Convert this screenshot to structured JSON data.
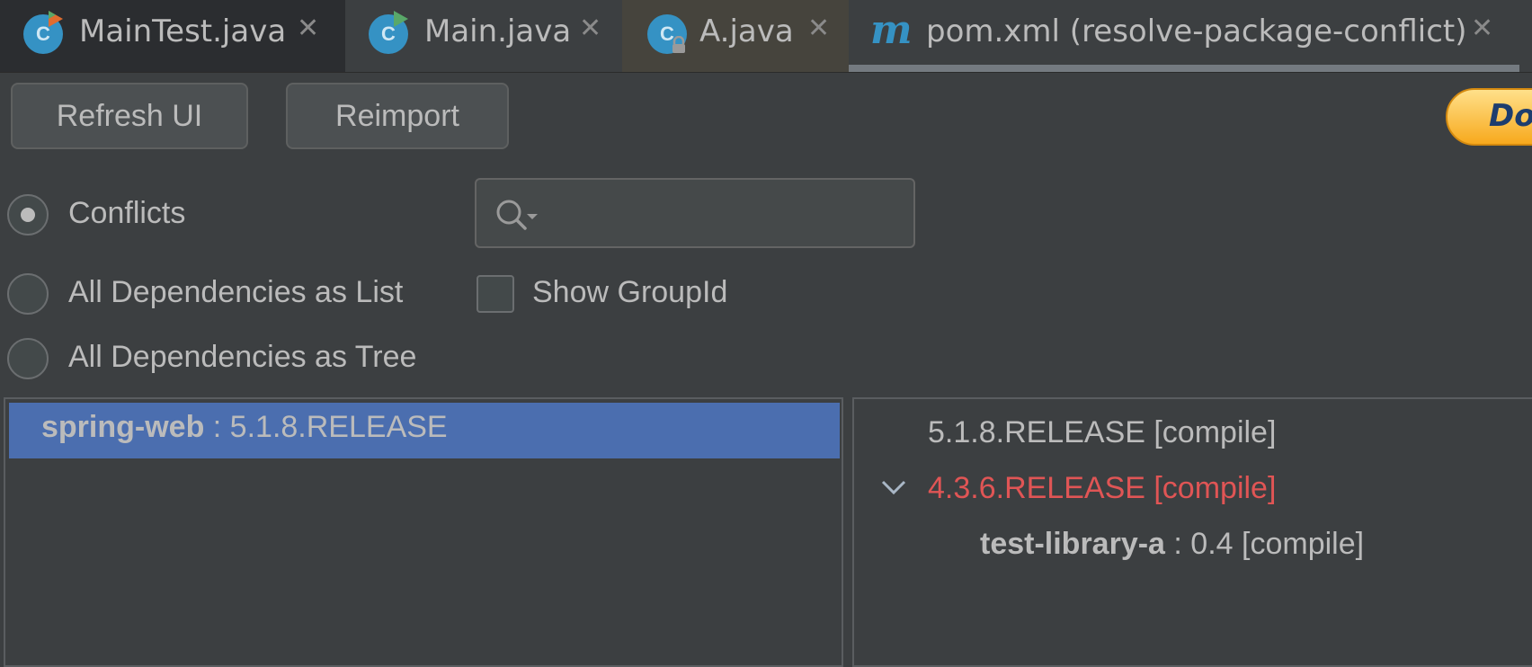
{
  "tabs": [
    {
      "label": "MainTest.java",
      "icon": "class-test-icon"
    },
    {
      "label": "Main.java",
      "icon": "class-run-icon"
    },
    {
      "label": "A.java",
      "icon": "class-locked-icon"
    },
    {
      "label": "pom.xml (resolve-package-conflict)",
      "icon": "maven-icon",
      "icon_text": "m",
      "active": true
    }
  ],
  "tab_close_glyph": "✕",
  "toolbar": {
    "refresh_label": "Refresh UI",
    "reimport_label": "Reimport",
    "donate_label": "Do"
  },
  "view_options": {
    "conflicts_label": "Conflicts",
    "list_label": "All Dependencies as List",
    "tree_label": "All Dependencies as Tree",
    "selected": "Conflicts"
  },
  "search": {
    "value": ""
  },
  "show_group_id": {
    "label": "Show GroupId",
    "checked": false
  },
  "left_list": {
    "items": [
      {
        "name": "spring-web",
        "version": " : 5.1.8.RELEASE",
        "selected": true
      }
    ]
  },
  "right_tree": {
    "rows": [
      {
        "text": "5.1.8.RELEASE [compile]",
        "conflict": false
      },
      {
        "text": "4.3.6.RELEASE [compile]",
        "conflict": true,
        "expanded": true
      },
      {
        "name": "test-library-a",
        "detail": " : 0.4 [compile]"
      }
    ]
  },
  "colors": {
    "background": "#3c3f41",
    "selection": "#4b6eaf",
    "conflict": "#e05555",
    "text": "#bbbbbb",
    "class_icon": "#3592c4"
  }
}
